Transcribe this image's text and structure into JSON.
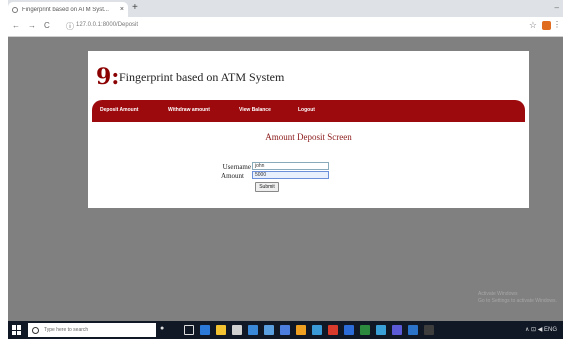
{
  "browser": {
    "tab_title": "Fingerprint based on ATM Syst...",
    "tab_close": "×",
    "new_tab": "+",
    "minimize": "–",
    "address": "127.0.0.1:8000/Deposit",
    "back": "←",
    "forward": "→",
    "reload": "C",
    "info": "ⓘ",
    "star": "☆",
    "menu": "⋮"
  },
  "site": {
    "logo_glyph": "9:",
    "title": "Fingerprint based on ATM System",
    "nav": [
      "Deposit Amount",
      "Withdraw amount",
      "View Balance",
      "Logout"
    ]
  },
  "form": {
    "heading": "Amount Deposit Screen",
    "username_label": "Username",
    "username_value": "john",
    "amount_label": "Amount",
    "amount_value": "5000",
    "submit_label": "Submit"
  },
  "watermark": {
    "line1": "Activate Windows",
    "line2": "Go to Settings to activate Windows."
  },
  "taskbar": {
    "search_placeholder": "Type here to search",
    "tray_text": "∧ ⊡ ◀ ENG"
  },
  "colors": {
    "nav_bg": "#9d0a0e",
    "accent_text": "#8b1a1a",
    "viewport_bg": "#808080"
  }
}
